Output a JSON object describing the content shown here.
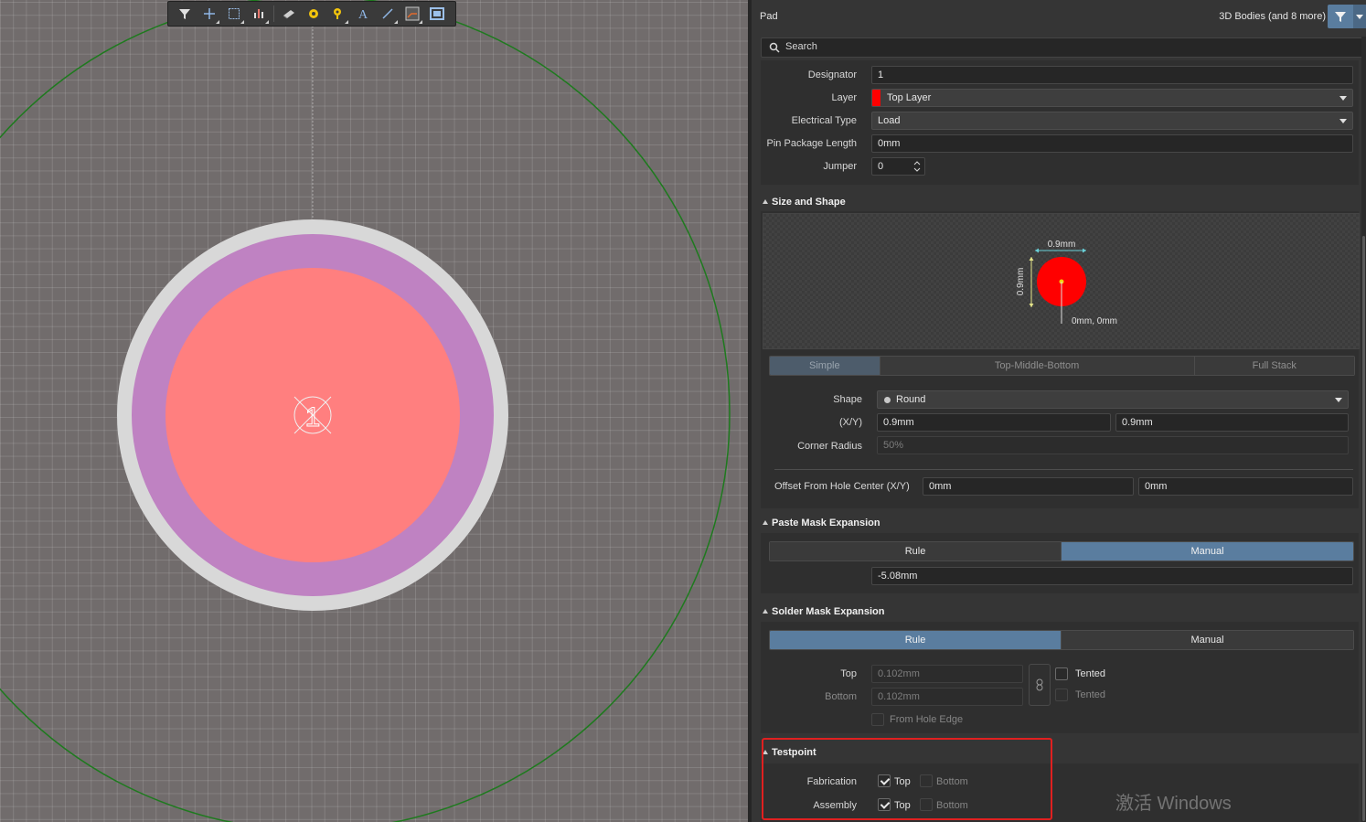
{
  "panel": {
    "title": "Pad",
    "selection_filter": "3D Bodies (and 8 more)",
    "search_placeholder": "Search"
  },
  "properties": {
    "designator": {
      "label": "Designator",
      "value": "1"
    },
    "layer": {
      "label": "Layer",
      "value": "Top Layer",
      "color": "#ff0000"
    },
    "electrical_type": {
      "label": "Electrical Type",
      "value": "Load"
    },
    "pin_package_length": {
      "label": "Pin Package Length",
      "value": "0mm"
    },
    "jumper": {
      "label": "Jumper",
      "value": "0"
    }
  },
  "size_shape": {
    "title": "Size and Shape",
    "preview": {
      "width_label": "0.9mm",
      "height_label": "0.9mm",
      "origin_label": "0mm, 0mm",
      "pad_color": "#ff0000"
    },
    "tabs": [
      "Simple",
      "Top-Middle-Bottom",
      "Full Stack"
    ],
    "shape": {
      "label": "Shape",
      "value": "Round"
    },
    "xy": {
      "label": "(X/Y)",
      "x": "0.9mm",
      "y": "0.9mm"
    },
    "corner_radius": {
      "label": "Corner Radius",
      "value": "50%"
    },
    "offset": {
      "label": "Offset From Hole Center (X/Y)",
      "x": "0mm",
      "y": "0mm"
    }
  },
  "paste_mask": {
    "title": "Paste Mask Expansion",
    "tabs": [
      "Rule",
      "Manual"
    ],
    "value": "-5.08mm"
  },
  "solder_mask": {
    "title": "Solder Mask Expansion",
    "tabs": [
      "Rule",
      "Manual"
    ],
    "top": {
      "label": "Top",
      "value": "0.102mm",
      "tented": "Tented"
    },
    "bottom": {
      "label": "Bottom",
      "value": "0.102mm",
      "tented": "Tented"
    },
    "from_hole_edge": "From Hole Edge"
  },
  "testpoint": {
    "title": "Testpoint",
    "fabrication": {
      "label": "Fabrication",
      "top": "Top",
      "bottom": "Bottom"
    },
    "assembly": {
      "label": "Assembly",
      "top": "Top",
      "bottom": "Bottom"
    }
  },
  "canvas": {
    "pad_designator": "1",
    "colors": {
      "pad": "#ff7f7f",
      "solder_mask": "#bf82c2",
      "paste": "#d8d8d8",
      "courtyard": "#1e7a1e"
    }
  },
  "icons": [
    "filter-icon",
    "crosshair-icon",
    "select-rect-icon",
    "bar-chart-icon",
    "component-icon",
    "pad-icon",
    "via-icon",
    "text-icon",
    "line-icon",
    "route-icon",
    "dimension-icon",
    "search-icon",
    "funnel-icon"
  ],
  "watermark": "激活 Windows"
}
